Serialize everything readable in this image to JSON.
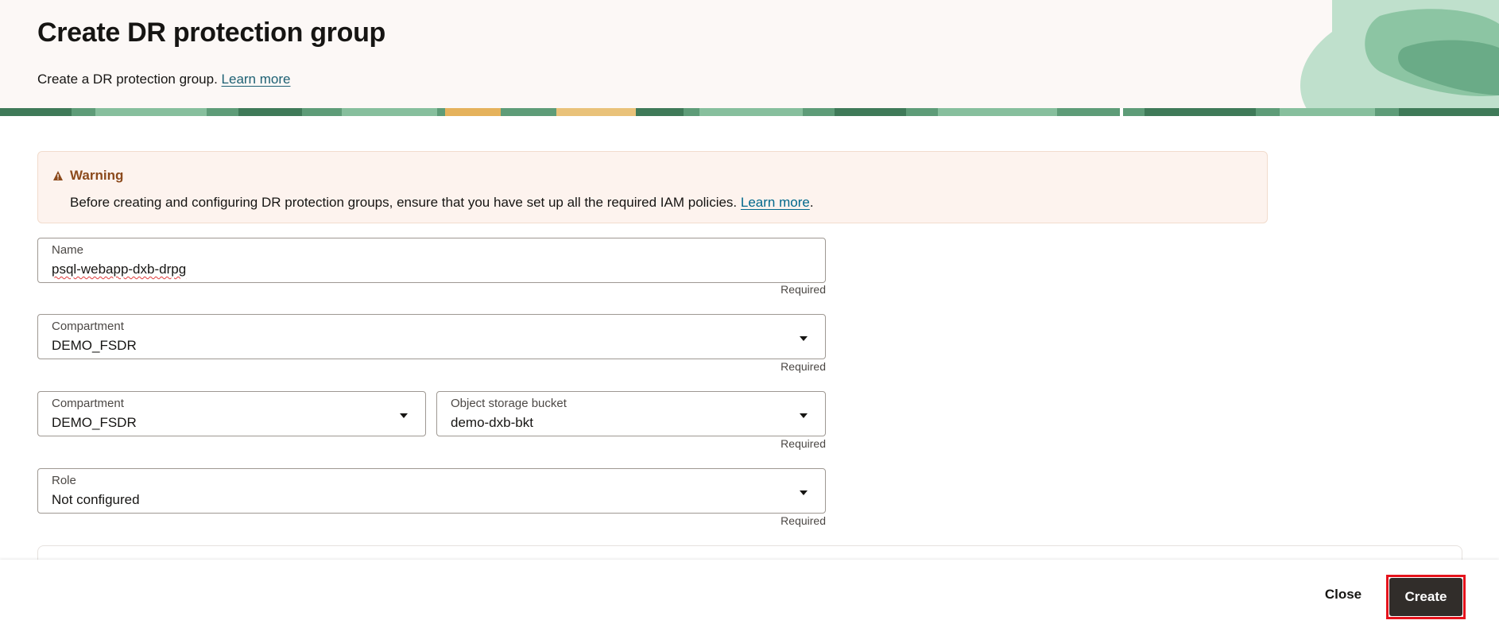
{
  "header": {
    "title": "Create DR protection group",
    "description": "Create a DR protection group.",
    "learn_more": "Learn more"
  },
  "warning": {
    "title": "Warning",
    "body": "Before creating and configuring DR protection groups, ensure that you have set up all the required IAM policies.",
    "learn_more": "Learn more",
    "trailing": "."
  },
  "form": {
    "name": {
      "label": "Name",
      "value": "psql-webapp-dxb-drpg",
      "required": "Required"
    },
    "compartment": {
      "label": "Compartment",
      "value": "DEMO_FSDR",
      "required": "Required"
    },
    "bucket_compartment": {
      "label": "Compartment",
      "value": "DEMO_FSDR"
    },
    "bucket": {
      "label": "Object storage bucket",
      "value": "demo-dxb-bkt",
      "required": "Required"
    },
    "role": {
      "label": "Role",
      "value": "Not configured",
      "required": "Required"
    }
  },
  "footer": {
    "close_label": "Close",
    "create_label": "Create"
  },
  "colors": {
    "header_bg": "#fcf8f6",
    "warning_bg": "#fdf3ee",
    "warning_title": "#8c4a1c",
    "link": "#00688c",
    "primary_button": "#312d2a",
    "highlight_ring": "#e5131c"
  }
}
